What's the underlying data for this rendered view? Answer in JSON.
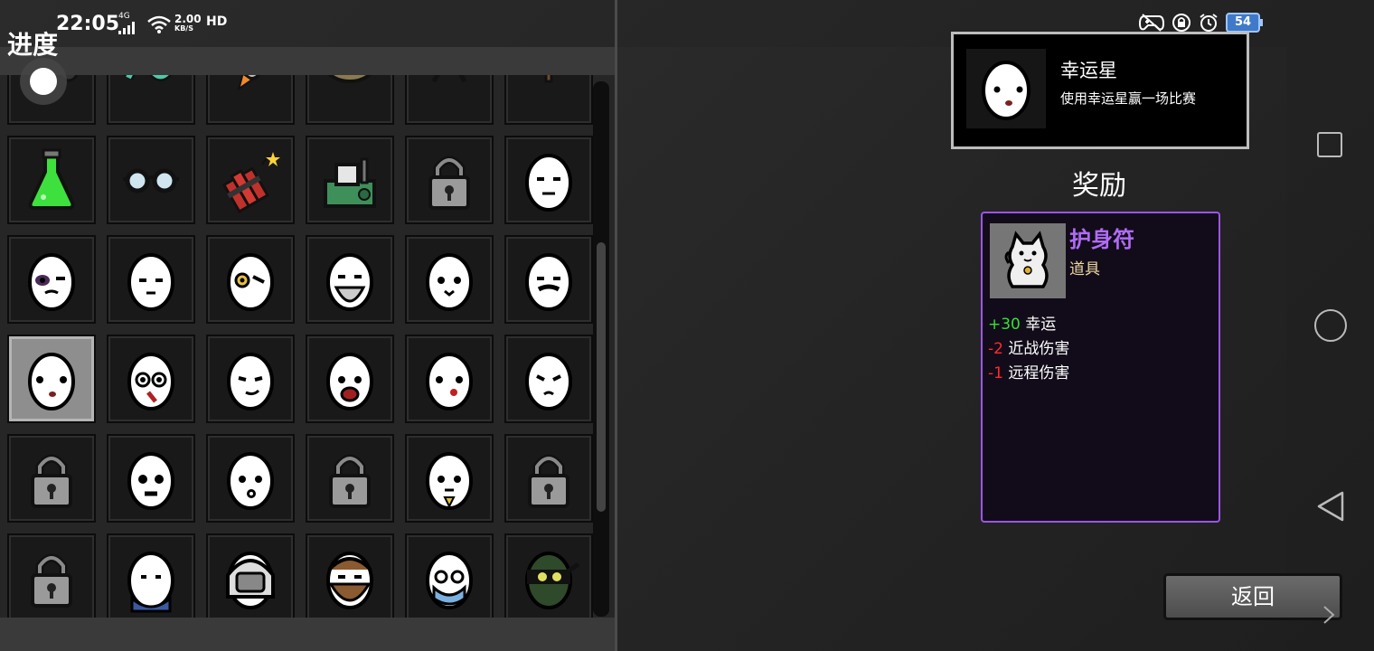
{
  "status_bar": {
    "time": "22:05",
    "network": "4G",
    "speed_value": "2.00",
    "speed_unit": "KB/S",
    "hd": "HD",
    "battery": "54"
  },
  "page": {
    "title": "进度"
  },
  "collection": {
    "rows": [
      [
        "lawnmower-icon",
        "tentacle-icon",
        "rocket-icon",
        "money-bag-icon",
        "turret-icon",
        "tree-icon"
      ],
      [
        "potion-icon",
        "glasses-icon",
        "dynamite-icon",
        "machine-icon",
        "lock-icon",
        "egg-frown-icon"
      ],
      [
        "egg-black-eye-icon",
        "egg-squint-icon",
        "egg-monocle-icon",
        "egg-old-beard-icon",
        "egg-cute-icon",
        "egg-mustache-icon"
      ],
      [
        "egg-lucky-selected-icon",
        "egg-scared-icon",
        "egg-sly-icon",
        "egg-shout-icon",
        "egg-tongue-icon",
        "egg-worried-icon"
      ],
      [
        "lock-icon",
        "egg-grumpy-icon",
        "egg-whistle-icon",
        "lock-icon",
        "egg-goatee-icon",
        "lock-icon"
      ],
      [
        "lock-icon",
        "egg-suit-icon",
        "egg-helmet-icon",
        "egg-bearded-icon",
        "egg-masked-icon",
        "egg-ninja-icon"
      ]
    ],
    "selected_index": 18
  },
  "achievement": {
    "title": "幸运星",
    "description": "使用幸运星赢一场比赛",
    "icon": "egg-lucky-icon"
  },
  "reward": {
    "heading": "奖励",
    "name": "护身符",
    "type": "道具",
    "icon": "lucky-cat-icon",
    "name_color": "#b06cf5",
    "stats": [
      {
        "value": "+30",
        "label": "幸运",
        "color": "#36e036"
      },
      {
        "value": "-2",
        "label": "近战伤害",
        "color": "#ff2a2a"
      },
      {
        "value": "-1",
        "label": "远程伤害",
        "color": "#ff2a2a"
      }
    ]
  },
  "back_button": {
    "label": "返回"
  }
}
